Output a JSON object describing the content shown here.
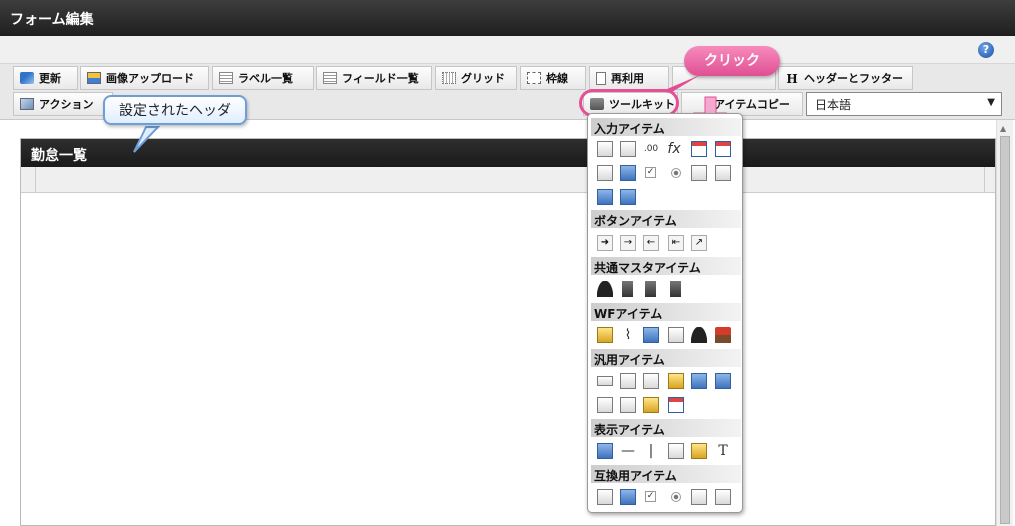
{
  "window": {
    "title": "フォーム編集"
  },
  "toolbar": {
    "row1": [
      {
        "label": "更新",
        "icon": "refresh-icon"
      },
      {
        "label": "画像アップロード",
        "icon": "image-upload-icon"
      },
      {
        "label": "ラベル一覧",
        "icon": "label-list-icon"
      },
      {
        "label": "フィールド一覧",
        "icon": "field-list-icon"
      },
      {
        "label": "グリッド",
        "icon": "grid-icon"
      },
      {
        "label": "枠線",
        "icon": "border-icon"
      },
      {
        "label": "再利用",
        "icon": "reuse-icon"
      },
      {
        "label": "ヘッダーとフッター",
        "icon": "header-footer-icon"
      }
    ],
    "row2": [
      {
        "label": "アクション",
        "icon": "action-icon"
      },
      {
        "label": "ツールキット",
        "icon": "toolkit-icon"
      },
      {
        "label": "アイテムコピー",
        "icon": "item-copy-icon"
      }
    ],
    "language": "日本語"
  },
  "callouts": {
    "click": "クリック",
    "header_set": "設定されたヘッダ"
  },
  "form": {
    "header_title": "勤怠一覧"
  },
  "toolkit": {
    "sections": [
      {
        "title": "入力アイテム"
      },
      {
        "title": "ボタンアイテム"
      },
      {
        "title": "共通マスタアイテム"
      },
      {
        "title": "WFアイテム"
      },
      {
        "title": "汎用アイテム"
      },
      {
        "title": "表示アイテム"
      },
      {
        "title": "互換用アイテム"
      }
    ]
  },
  "colors": {
    "accent_pink": "#e44f95",
    "callout_blue": "#6d9fd6",
    "header_dark": "#222222"
  }
}
